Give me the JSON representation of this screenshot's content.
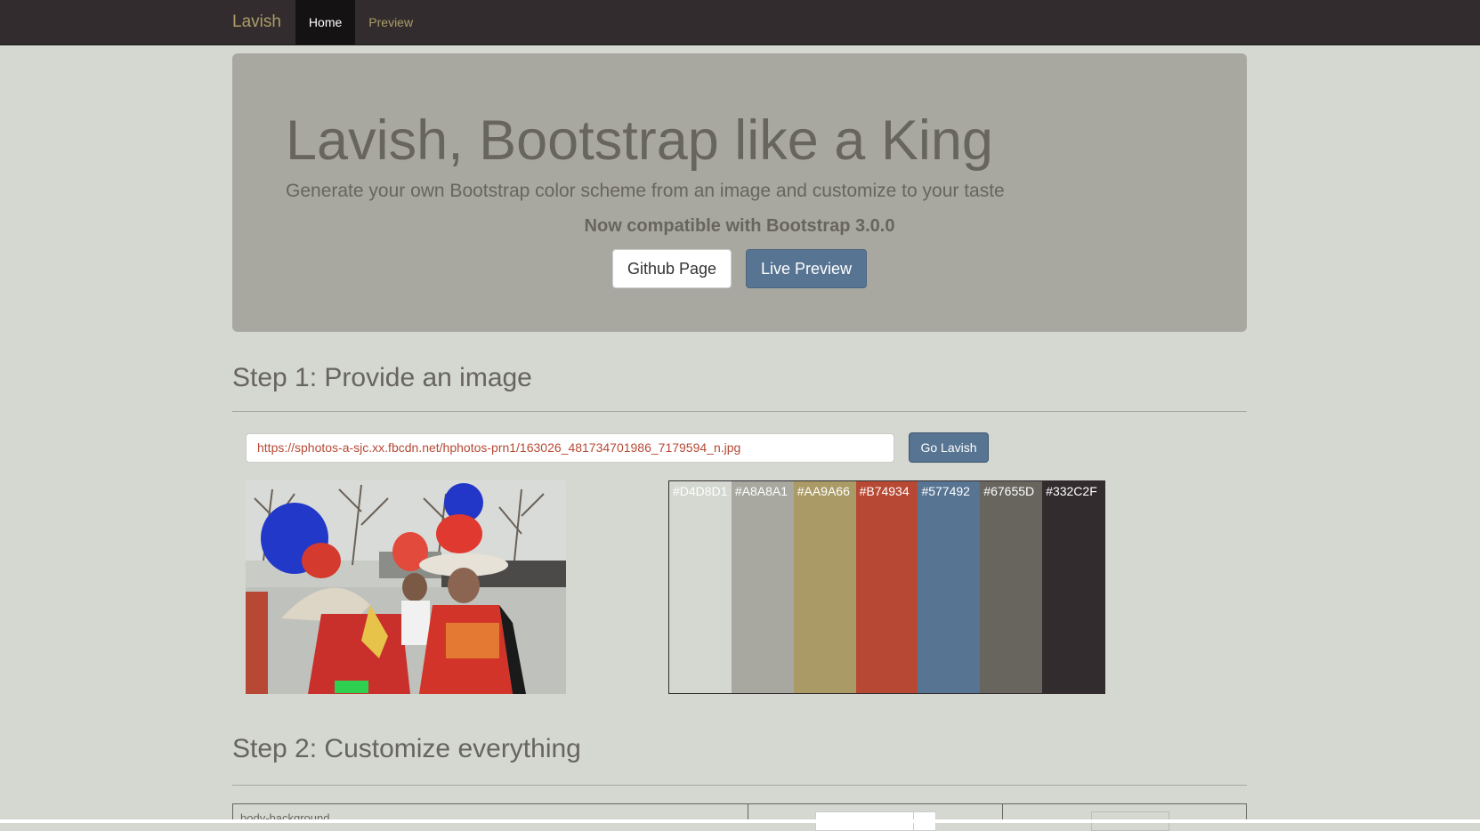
{
  "navbar": {
    "brand": "Lavish",
    "items": [
      {
        "label": "Home",
        "active": true
      },
      {
        "label": "Preview",
        "active": false
      }
    ]
  },
  "hero": {
    "title": "Lavish, Bootstrap like a King",
    "lead": "Generate your own Bootstrap color scheme from an image and customize to your taste",
    "compat": "Now compatible with Bootstrap 3.0.0",
    "github_button": "Github Page",
    "preview_button": "Live Preview"
  },
  "step1": {
    "title": "Step 1: Provide an image",
    "url_value": "https://sphotos-a-sjc.xx.fbcdn.net/hphotos-prn1/163026_481734701986_7179594_n.jpg",
    "go_button": "Go Lavish"
  },
  "palette": [
    {
      "label": "#D4D8D1",
      "color": "#d4d8d1"
    },
    {
      "label": "#A8A8A1",
      "color": "#a8a8a1"
    },
    {
      "label": "#AA9A66",
      "color": "#aa9a66"
    },
    {
      "label": "#B74934",
      "color": "#b74934"
    },
    {
      "label": "#577492",
      "color": "#577492"
    },
    {
      "label": "#67655D",
      "color": "#67655d"
    },
    {
      "label": "#332C2F",
      "color": "#332c2f"
    }
  ],
  "step2": {
    "title": "Step 2: Customize everything",
    "first_row_label": "body-background"
  }
}
